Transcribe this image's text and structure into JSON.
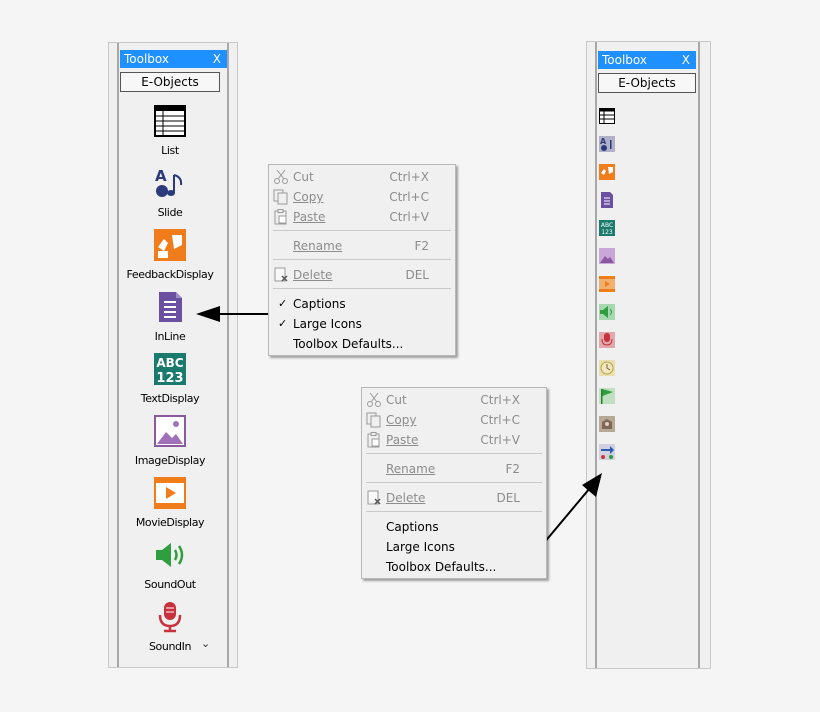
{
  "left_toolbox": {
    "title": "Toolbox",
    "close": "X",
    "tab": "E-Objects",
    "tools": [
      {
        "name": "list",
        "caption": "List"
      },
      {
        "name": "slide",
        "caption": "Slide"
      },
      {
        "name": "feedback-display",
        "caption": "FeedbackDisplay"
      },
      {
        "name": "inline",
        "caption": "InLine"
      },
      {
        "name": "text-display",
        "caption": "TextDisplay"
      },
      {
        "name": "image-display",
        "caption": "ImageDisplay"
      },
      {
        "name": "movie-display",
        "caption": "MovieDisplay"
      },
      {
        "name": "sound-out",
        "caption": "SoundOut"
      },
      {
        "name": "sound-in",
        "caption": "SoundIn"
      }
    ],
    "scroll_down": "⌄"
  },
  "right_toolbox": {
    "title": "Toolbox",
    "close": "X",
    "tab": "E-Objects",
    "icons": [
      "list-icon",
      "slide-icon",
      "feedback-icon",
      "inline-icon",
      "text-display-icon",
      "image-display-icon",
      "movie-display-icon",
      "sound-out-icon",
      "sound-in-icon",
      "clock-icon",
      "flag-icon",
      "package-icon",
      "script-icon"
    ]
  },
  "text_icon": {
    "line1": "ABC",
    "line2": "123"
  },
  "menu_top": {
    "cut": {
      "label": "Cut",
      "shortcut": "Ctrl+X"
    },
    "copy": {
      "label": "Copy",
      "shortcut": "Ctrl+C"
    },
    "paste": {
      "label": "Paste",
      "shortcut": "Ctrl+V"
    },
    "rename": {
      "label": "Rename",
      "shortcut": "F2"
    },
    "delete": {
      "label": "Delete",
      "shortcut": "DEL"
    },
    "captions": {
      "label": "Captions",
      "checked": "✓"
    },
    "large_icons": {
      "label": "Large Icons",
      "checked": "✓"
    },
    "defaults": {
      "label": "Toolbox Defaults..."
    }
  },
  "menu_bottom": {
    "cut": {
      "label": "Cut",
      "shortcut": "Ctrl+X"
    },
    "copy": {
      "label": "Copy",
      "shortcut": "Ctrl+C"
    },
    "paste": {
      "label": "Paste",
      "shortcut": "Ctrl+V"
    },
    "rename": {
      "label": "Rename",
      "shortcut": "F2"
    },
    "delete": {
      "label": "Delete",
      "shortcut": "DEL"
    },
    "captions": {
      "label": "Captions"
    },
    "large_icons": {
      "label": "Large Icons"
    },
    "defaults": {
      "label": "Toolbox Defaults..."
    }
  },
  "colors": {
    "titlebar": "#1e90ff",
    "orange": "#f07c1c",
    "purple": "#6b4fa0",
    "teal": "#1a7a6e",
    "green": "#2e9e3e",
    "red": "#c8323c",
    "navy": "#2b3a7a"
  }
}
